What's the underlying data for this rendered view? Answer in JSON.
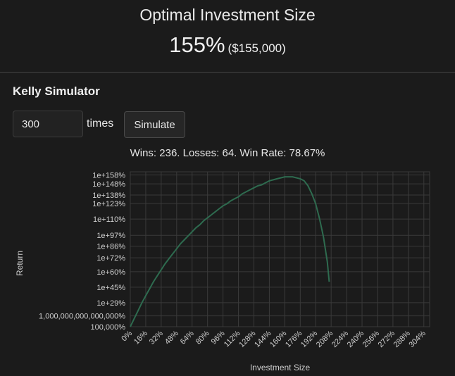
{
  "header": {
    "title": "Optimal Investment Size",
    "percent": "155%",
    "amount": "($155,000)"
  },
  "simulator": {
    "title": "Kelly Simulator",
    "times_value": "300",
    "times_label": "times",
    "simulate_label": "Simulate",
    "stats": "Wins: 236. Losses: 64. Win Rate: 78.67%"
  },
  "chart_data": {
    "type": "line",
    "xlabel": "Investment Size",
    "ylabel": "Return",
    "x_ticks": [
      "0%",
      "16%",
      "32%",
      "48%",
      "64%",
      "80%",
      "96%",
      "112%",
      "128%",
      "144%",
      "160%",
      "176%",
      "192%",
      "208%",
      "224%",
      "240%",
      "256%",
      "272%",
      "288%",
      "304%"
    ],
    "y_ticks": [
      "100,000%",
      "1,000,000,000,000,000%",
      "1e+29%",
      "1e+45%",
      "1e+60%",
      "1e+72%",
      "1e+86%",
      "1e+97%",
      "1e+110%",
      "1e+123%",
      "1e+138%",
      "1e+148%",
      "1e+158%"
    ],
    "grid": true,
    "series_color": "#2e6b4f",
    "series": [
      {
        "x": [
          0,
          4,
          8,
          12,
          16,
          20,
          24,
          28,
          32,
          36,
          40,
          44,
          48,
          52,
          56,
          60,
          64,
          68,
          72,
          76,
          80,
          84,
          88,
          92,
          96,
          100,
          104,
          108,
          112,
          116,
          120,
          124,
          128,
          132,
          136,
          140,
          144,
          148,
          152,
          156,
          160,
          164,
          168,
          172,
          176,
          180,
          184,
          188,
          192,
          196,
          200,
          204,
          206
        ],
        "y": [
          0,
          8,
          16,
          24,
          31,
          38,
          45,
          51,
          57,
          63,
          68,
          73,
          78,
          83,
          87,
          91,
          95,
          99,
          102,
          106,
          109,
          112,
          115,
          118,
          121,
          123,
          126,
          128,
          130,
          133,
          135,
          137,
          139,
          141,
          142,
          144,
          146,
          147,
          148,
          149,
          150,
          150,
          150,
          149,
          148,
          146,
          141,
          133,
          123,
          108,
          90,
          65,
          45
        ]
      }
    ]
  }
}
